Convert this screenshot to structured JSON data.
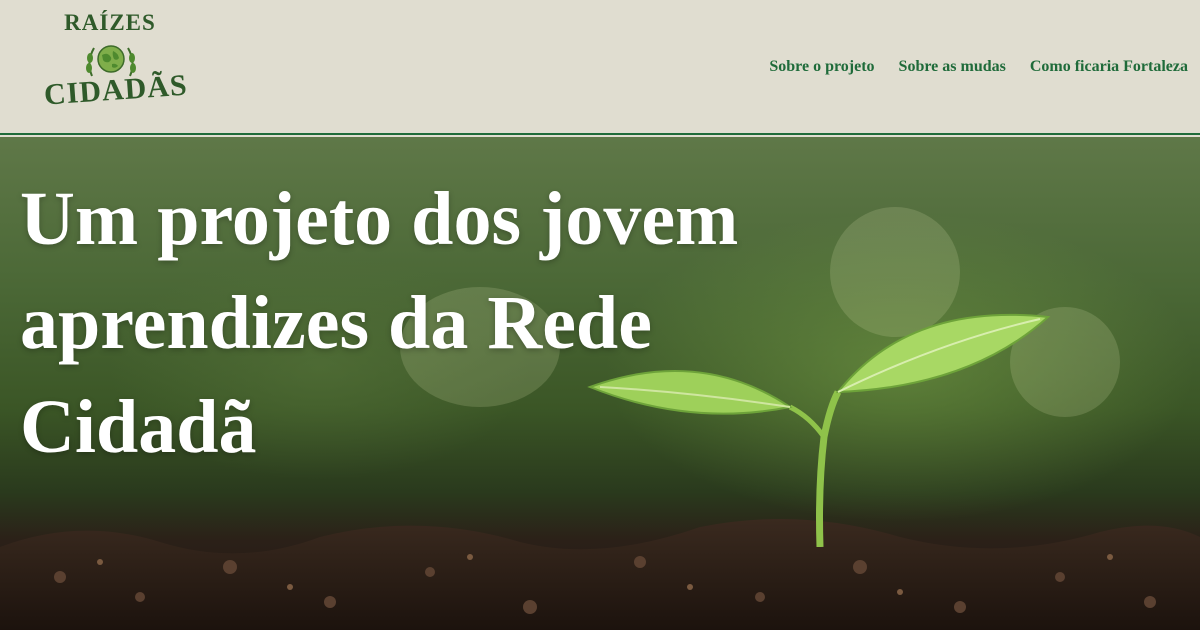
{
  "brand": {
    "line1": "RAÍZES",
    "line2": "CIDADÃS"
  },
  "nav": {
    "items": [
      {
        "label": "Sobre o projeto"
      },
      {
        "label": "Sobre as mudas"
      },
      {
        "label": "Como ficaria Fortaleza"
      }
    ]
  },
  "hero": {
    "title": "Um projeto dos jovem aprendizes da Rede Cidadã",
    "image": "seedling-in-soil"
  },
  "colors": {
    "header_bg": "#e0ddd0",
    "accent": "#1f6b3a",
    "brand_green": "#2f5a2a",
    "hero_text": "#ffffff"
  }
}
